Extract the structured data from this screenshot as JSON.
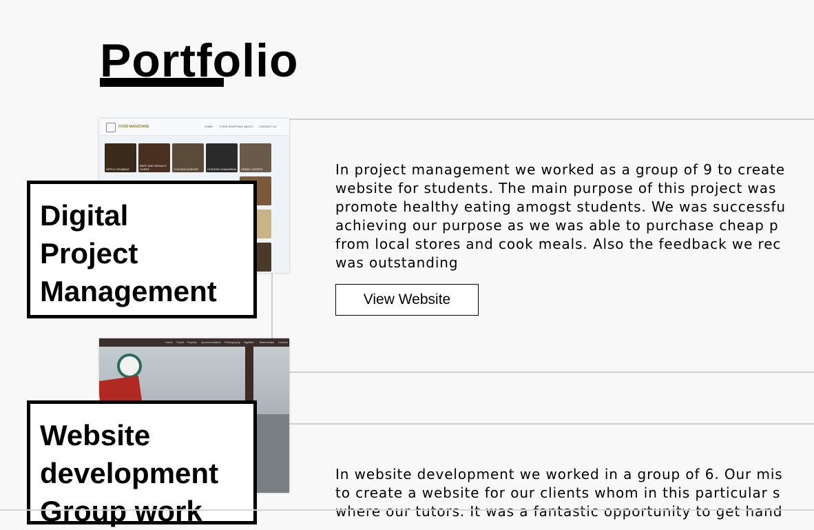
{
  "page": {
    "title": "Portfolio"
  },
  "projects": [
    {
      "label_lines": [
        "Digital",
        "Project",
        "Management"
      ],
      "description_lines": [
        "In project management we worked as a group of 9 to create",
        "website for students. The main purpose of this project was",
        "promote healthy eating amogst students. We was successfu",
        "achieving our purpose as we was able to purchase cheap p",
        "from local stores and cook meals. Also the feedback we rec",
        "was outstanding"
      ],
      "button_label": "View Website",
      "thumbnail": {
        "brand": "FOOD MAGICIANS",
        "nav": [
          "HOME",
          "FOOD SHOPPING",
          "ABOUT",
          "CONTACT US"
        ],
        "cells": [
          "APPLE CRUMBLE",
          "BEEF AND SPINACH CURRY",
          "CHICKEN BURGER",
          "CHICKEN SHAWARMA",
          "GREEK CREPES"
        ]
      }
    },
    {
      "label_lines": [
        "Website",
        "development",
        "Group work"
      ],
      "description_lines": [
        "In website development we worked in a group of 6. Our mis",
        "to create a website for our clients whom in this particular s",
        "where our tutors. It was a fantastic opportunity to get hand"
      ],
      "thumbnail": {
        "nav": [
          "Home",
          "Travel",
          "Popular",
          "Accommodation",
          "Photography",
          "Nightlife",
          "Testimonials",
          "Contact"
        ]
      }
    }
  ]
}
